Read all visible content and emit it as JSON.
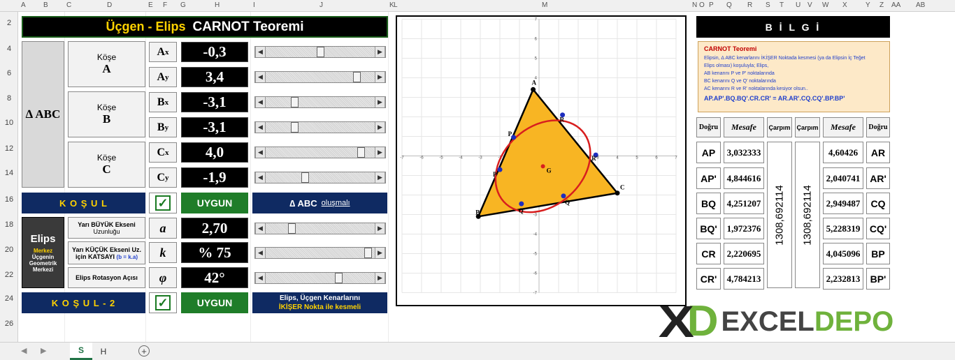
{
  "col_headers": [
    "A",
    "B",
    "C",
    "D",
    "E",
    "F",
    "G",
    "H",
    "I",
    "J",
    "K",
    "L",
    "M",
    "N",
    "O",
    "P",
    "Q",
    "R",
    "S",
    "T",
    "U",
    "V",
    "W",
    "X",
    "Y",
    "Z",
    "AA",
    "AB"
  ],
  "row_headers": [
    "2",
    "4",
    "6",
    "8",
    "10",
    "12",
    "14",
    "16",
    "18",
    "20",
    "22",
    "24",
    "26"
  ],
  "title": {
    "part1": "Üçgen - Elips",
    "part2": "CARNOT Teoremi"
  },
  "triangle_label": "∆ ABC",
  "kose": [
    {
      "word": "Köşe",
      "letter": "A"
    },
    {
      "word": "Köşe",
      "letter": "B"
    },
    {
      "word": "Köşe",
      "letter": "C"
    }
  ],
  "coords": [
    {
      "base": "A",
      "sub": "x",
      "value": "-0,3",
      "slider": 0.5
    },
    {
      "base": "A",
      "sub": "y",
      "value": "3,4",
      "slider": 0.86
    },
    {
      "base": "B",
      "sub": "x",
      "value": "-3,1",
      "slider": 0.25
    },
    {
      "base": "B",
      "sub": "y",
      "value": "-3,1",
      "slider": 0.25
    },
    {
      "base": "C",
      "sub": "x",
      "value": "4,0",
      "slider": 0.9
    },
    {
      "base": "C",
      "sub": "y",
      "value": "-1,9",
      "slider": 0.35
    }
  ],
  "kosul": {
    "label": "K O Ş U L",
    "check": "✓",
    "status": "UYGUN",
    "note_prefix": "∆ ABC",
    "note_link": "oluşmalı"
  },
  "elips": {
    "title": "Elips",
    "sub1": "Merkez",
    "sub2": "Üçgenin",
    "sub3": "Geometrik",
    "sub4": "Merkezi"
  },
  "params": [
    {
      "label1": "Yarı BÜYÜK Ekseni",
      "label2": "Uzunluğu",
      "symbol": "a",
      "value": "2,70",
      "slider": 0.22
    },
    {
      "label1": "Yarı KÜÇÜK Ekseni Uz.",
      "label2": "için KATSAYI",
      "label3": "(b = k.a)",
      "symbol": "k",
      "value": "% 75",
      "slider": 0.97
    },
    {
      "label1": "Elips Rotasyon Açısı",
      "symbol": "φ",
      "value": "42°",
      "slider": 0.68
    }
  ],
  "kosul2": {
    "label": "K O Ş U L - 2",
    "check": "✓",
    "status": "UYGUN",
    "note1": "Elips, Üçgen Kenarlarını",
    "note2": "İKİŞER Nokta ile kesmeli"
  },
  "chart_data": {
    "type": "scatter",
    "xlim": [
      -7,
      7
    ],
    "ylim": [
      -7,
      7
    ],
    "ticks": [
      "-7",
      "-6",
      "-5",
      "-4",
      "-3",
      "-2",
      "-1",
      "0",
      "1",
      "2",
      "3",
      "4",
      "5",
      "6",
      "7"
    ],
    "triangle": [
      {
        "name": "A",
        "x": -0.3,
        "y": 3.4
      },
      {
        "name": "B",
        "x": -3.1,
        "y": -3.1
      },
      {
        "name": "C",
        "x": 4.0,
        "y": -1.9
      }
    ],
    "centroid": {
      "name": "G",
      "x": 0.2,
      "y": -0.53
    },
    "ellipse": {
      "cx": 0.2,
      "cy": -0.53,
      "a": 2.7,
      "k": 0.75,
      "angle_deg": 42
    },
    "points": [
      {
        "name": "P",
        "x": -1.3,
        "y": 0.95
      },
      {
        "name": "P'",
        "x": -2.0,
        "y": -0.7
      },
      {
        "name": "Q",
        "x": 1.25,
        "y": -2.05
      },
      {
        "name": "Q'",
        "x": -0.9,
        "y": -2.45
      },
      {
        "name": "R",
        "x": 1.2,
        "y": 2.1
      },
      {
        "name": "R'",
        "x": 2.9,
        "y": 0.05
      }
    ]
  },
  "bilgi": {
    "title": "B İ L G İ",
    "heading": "CARNOT Teoremi",
    "lines": [
      "Elipsin, ∆ ABC kenarlarını İKİŞER Noktada kesmesi (ya da Elipsin İç Teğet",
      "Elips olması) koşuluyla; Elips,",
      "AB kenarını  P  ve  P'  noktalarında",
      "BC kenarını  Q  ve  Q'  noktalarında",
      "AC kenarını  R  ve  R'  noktalarında  kesiyor olsun.."
    ],
    "formula": "AP.AP'.BQ.BQ'.CR.CR' = AR.AR'.CQ.CQ'.BP.BP'"
  },
  "table": {
    "headers": {
      "dogru": "Doğru",
      "mesafe": "Mesafe",
      "carpim": "Çarpım"
    },
    "left": [
      {
        "seg": "AP",
        "val": "3,032333"
      },
      {
        "seg": "AP'",
        "val": "4,844616"
      },
      {
        "seg": "BQ",
        "val": "4,251207"
      },
      {
        "seg": "BQ'",
        "val": "1,972376"
      },
      {
        "seg": "CR",
        "val": "2,220695"
      },
      {
        "seg": "CR'",
        "val": "4,784213"
      }
    ],
    "right": [
      {
        "seg": "AR",
        "val": "4,60426"
      },
      {
        "seg": "AR'",
        "val": "2,040741"
      },
      {
        "seg": "CQ",
        "val": "2,949487"
      },
      {
        "seg": "CQ'",
        "val": "5,228319"
      },
      {
        "seg": "BP",
        "val": "4,045096"
      },
      {
        "seg": "BP'",
        "val": "2,232813"
      }
    ],
    "product_left": "1308,692114",
    "product_right": "1308,692114"
  },
  "logo": {
    "x": "X",
    "d": "D",
    "text1": "EXCEL",
    "text2": "DEPO"
  },
  "sheet_tabs": [
    "S",
    "H"
  ]
}
